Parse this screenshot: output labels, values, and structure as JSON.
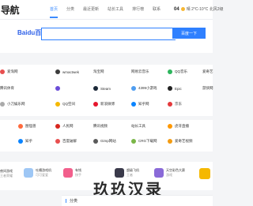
{
  "header": {
    "logo": "导航",
    "nav": [
      "首页",
      "分类",
      "最近更新",
      "站长工具",
      "排行榜",
      "联系"
    ],
    "weather_temp": "04",
    "weather_text": "晴 2°C-10°C 北风2级"
  },
  "search": {
    "engine": "Baidu百度",
    "button": "百度一下",
    "placeholder": ""
  },
  "sites": {
    "row1": [
      "爱淘网",
      "wmactwek",
      "淘宝网",
      "网易云音乐",
      "QQ音乐",
      "爱奇艺"
    ],
    "row2": [
      "腾讯体育",
      "",
      "Steam",
      "4399小游戏",
      "Epic",
      "游侠网"
    ],
    "row3": [
      "小刀娱乐网",
      "QQ空间",
      "新浪微博",
      "知乎网",
      "京东",
      ""
    ],
    "row4": [
      "图怪兽",
      "人民网",
      "腾讯视频",
      "站长工具",
      "虎牙直播",
      ""
    ],
    "row5": [
      "知乎",
      "百度破解",
      "Gimp网站",
      "CRG下载网",
      "爱奇艺视频",
      ""
    ]
  },
  "apps": [
    {
      "title": "夜间游戏",
      "sub": "王者荣耀"
    },
    {
      "title": "吐槽游戏机",
      "sub": "可可爱爱"
    },
    {
      "title": "有钱",
      "sub": "快手"
    },
    {
      "title": "超级飞机",
      "sub": "王者"
    },
    {
      "title": "天空彩色大赛",
      "sub": "游戏"
    }
  ],
  "bottom": {
    "label": "分类"
  },
  "watermark": "玖玖汉录",
  "colors": {
    "accent": "#3c8cff",
    "search_button": "#2f80ff"
  }
}
